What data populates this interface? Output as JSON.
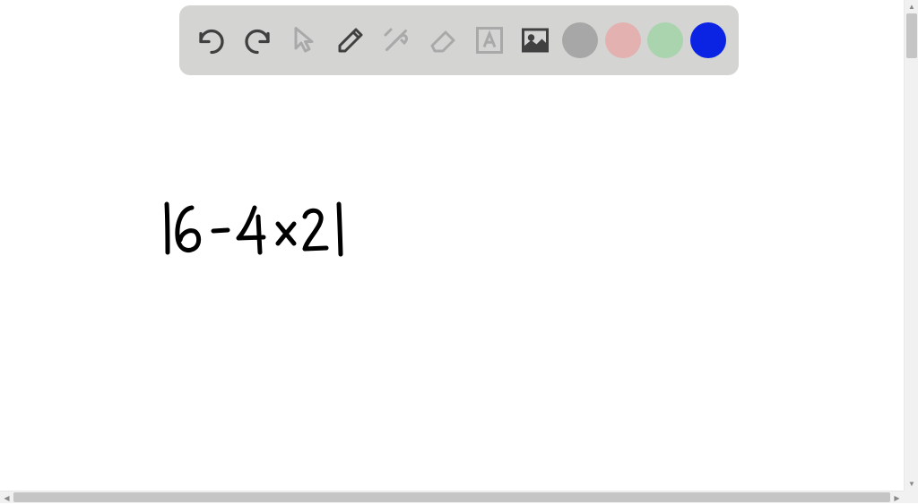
{
  "toolbar": {
    "tools": [
      {
        "name": "undo",
        "icon": "undo-icon"
      },
      {
        "name": "redo",
        "icon": "redo-icon"
      },
      {
        "name": "pointer",
        "icon": "pointer-icon"
      },
      {
        "name": "pencil",
        "icon": "pencil-icon"
      },
      {
        "name": "tools",
        "icon": "tools-icon"
      },
      {
        "name": "eraser",
        "icon": "eraser-icon"
      },
      {
        "name": "text",
        "icon": "text-icon"
      },
      {
        "name": "image",
        "icon": "image-icon"
      }
    ],
    "colors": [
      {
        "name": "gray",
        "hex": "#a7a7a7"
      },
      {
        "name": "pink",
        "hex": "#e4b1b1"
      },
      {
        "name": "green",
        "hex": "#a9d4ad"
      },
      {
        "name": "blue",
        "hex": "#0b24e3"
      }
    ],
    "selected_color": "blue"
  },
  "canvas": {
    "handwritten_expression": "|6 - 4 × 2|"
  }
}
